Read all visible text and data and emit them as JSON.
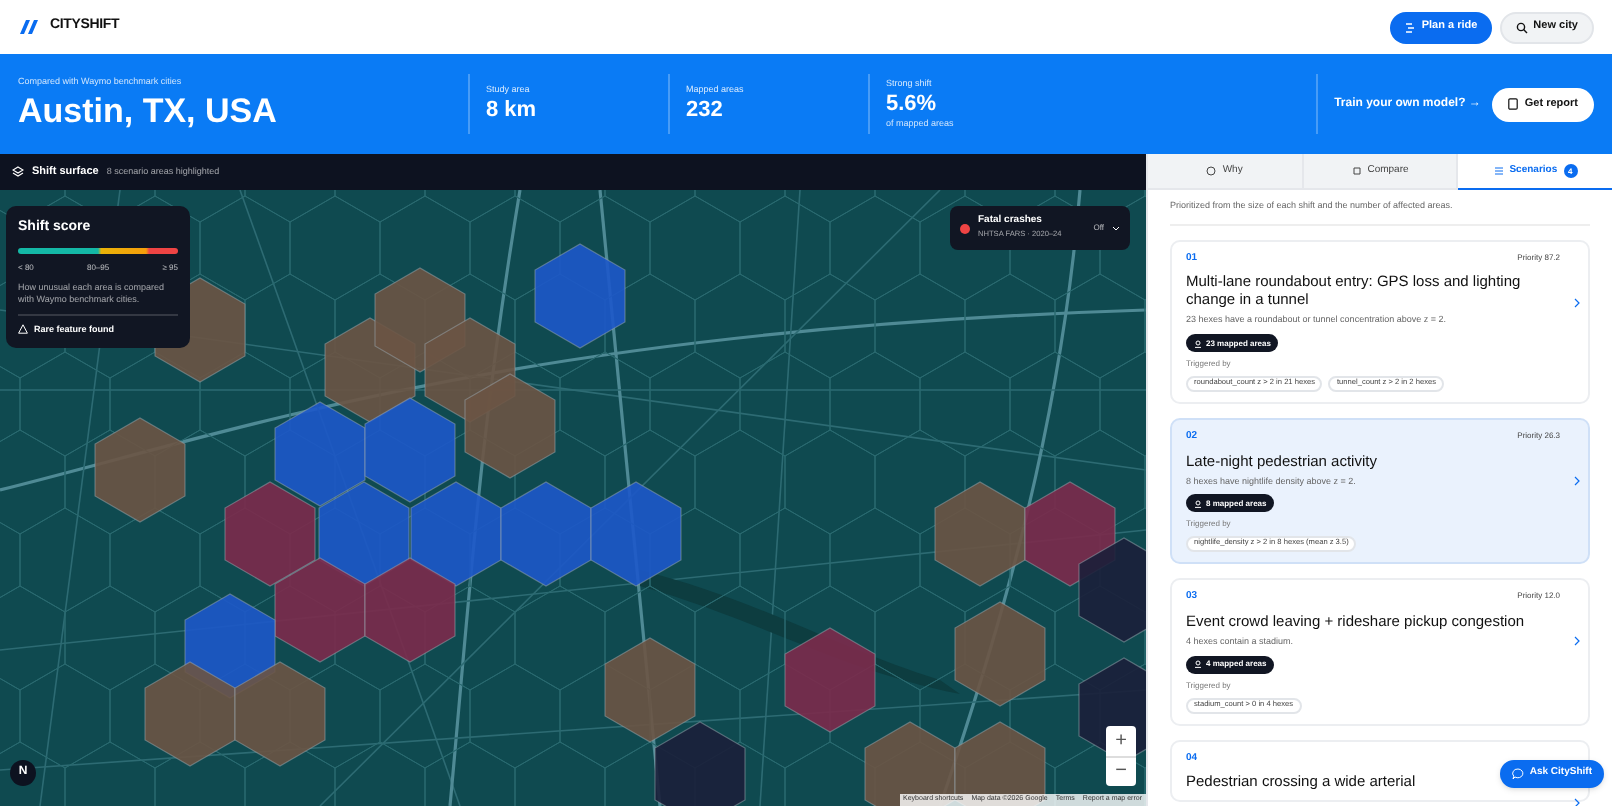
{
  "header": {
    "brand": "CITYSHIFT",
    "buttons": [
      {
        "label": "Plan a ride",
        "kind": "primary"
      },
      {
        "label": "New city",
        "kind": "secondary"
      }
    ]
  },
  "banner": {
    "subtitle": "Compared with Waymo benchmark cities",
    "city": "Austin, TX, USA",
    "stats": [
      {
        "label": "Study area",
        "value": "8 km"
      },
      {
        "label": "Mapped areas",
        "value": "232"
      },
      {
        "label": "Strong shift",
        "value": "5.6%",
        "note": "of mapped areas"
      }
    ],
    "train_link": "Train your own model? →",
    "report_button": "Get report"
  },
  "map_bar": {
    "title": "Shift surface",
    "note": "8 scenario areas highlighted"
  },
  "legend": {
    "title": "Shift score",
    "ticks": [
      "< 80",
      "80–95",
      "≥ 95"
    ],
    "description": "How unusual each area is compared with Waymo benchmark cities.",
    "flag": "Rare feature found"
  },
  "overlay_toggle": {
    "title": "Fatal crashes",
    "source": "NHTSA FARS · 2020–24",
    "value": "Off",
    "color": "#ef4444"
  },
  "map_controls": {
    "zoom_in": "+",
    "zoom_out": "−",
    "compass": "N"
  },
  "attribution": [
    "Keyboard shortcuts",
    "Map data ©2026 Google",
    "Terms",
    "Report a map error"
  ],
  "tabs": [
    {
      "label": "Why",
      "selected": false
    },
    {
      "label": "Compare",
      "selected": false
    },
    {
      "label": "Scenarios",
      "selected": true,
      "badge": "4"
    }
  ],
  "intro": "Prioritized from the size of each shift and the number of affected areas.",
  "scenarios": [
    {
      "number": "01",
      "priority": "Priority 87.2",
      "title": "Multi-lane roundabout entry: GPS loss and lighting change in a tunnel",
      "description": "23 hexes have a roundabout or tunnel concentration above z = 2.",
      "areas": "23 mapped areas",
      "triggered_label": "Triggered by",
      "triggers": [
        "roundabout_count z > 2 in 21 hexes",
        "tunnel_count z > 2 in 2 hexes"
      ],
      "selected": false
    },
    {
      "number": "02",
      "priority": "Priority 26.3",
      "title": "Late-night pedestrian activity",
      "description": "8 hexes have nightlife density above z = 2.",
      "areas": "8 mapped areas",
      "triggered_label": "Triggered by",
      "triggers": [
        "nightlife_density z > 2 in 8 hexes (mean z 3.5)"
      ],
      "selected": true
    },
    {
      "number": "03",
      "priority": "Priority 12.0",
      "title": "Event crowd leaving + rideshare pickup congestion",
      "description": "4 hexes contain a stadium.",
      "areas": "4 mapped areas",
      "triggered_label": "Triggered by",
      "triggers": [
        "stadium_count > 0 in 4 hexes"
      ],
      "selected": false
    },
    {
      "number": "04",
      "title": "Pedestrian crossing a wide arterial",
      "selected": false
    }
  ],
  "ask_button": "Ask CityShift"
}
